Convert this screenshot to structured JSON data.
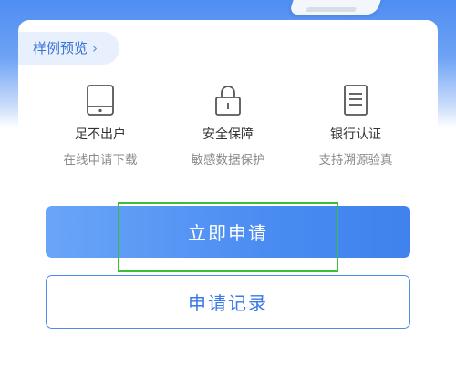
{
  "sample_preview": {
    "label": "样例预览",
    "chevron": "›"
  },
  "features": [
    {
      "icon": "tablet-icon",
      "title": "足不出户",
      "subtitle": "在线申请下载"
    },
    {
      "icon": "lock-icon",
      "title": "安全保障",
      "subtitle": "敏感数据保护"
    },
    {
      "icon": "document-icon",
      "title": "银行认证",
      "subtitle": "支持溯源验真"
    }
  ],
  "actions": {
    "apply_now": "立即申请",
    "apply_records": "申请记录"
  },
  "colors": {
    "brand_blue": "#4a8cf1",
    "highlight_green": "#3bbf3b"
  }
}
